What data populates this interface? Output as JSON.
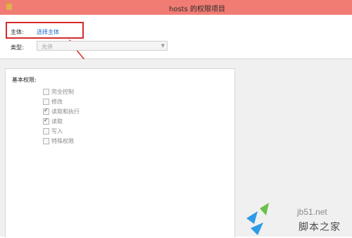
{
  "window": {
    "title": "hosts 的权限项目"
  },
  "principal": {
    "label": "主体:",
    "link_text": "选择主体"
  },
  "type": {
    "label": "类型:",
    "value": "允许"
  },
  "permissions": {
    "heading": "基本权限:",
    "items": [
      {
        "label": "完全控制",
        "checked": false
      },
      {
        "label": "修改",
        "checked": false
      },
      {
        "label": "读取和执行",
        "checked": true
      },
      {
        "label": "读取",
        "checked": true
      },
      {
        "label": "写入",
        "checked": false
      },
      {
        "label": "特殊权限",
        "checked": false
      }
    ]
  },
  "watermark": {
    "url": "jb51.net",
    "text": "脚本之家"
  },
  "colors": {
    "titlebar": "#f07c74",
    "highlight": "#d42b2b",
    "link": "#1a67c7"
  }
}
